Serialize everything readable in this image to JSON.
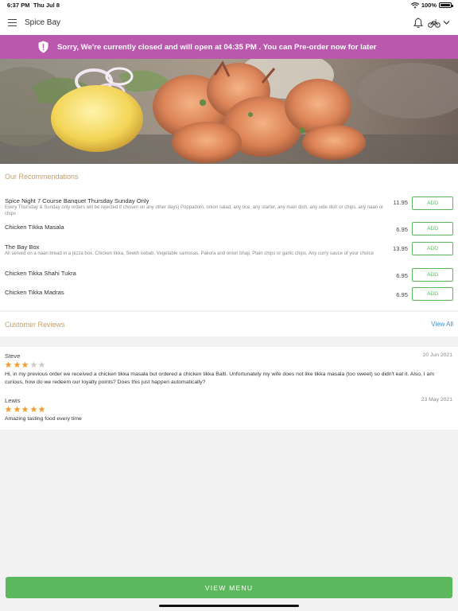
{
  "status_bar": {
    "time": "6:37 PM",
    "date": "Thu Jul 8",
    "battery": "100%"
  },
  "navbar": {
    "title": "Spice Bay"
  },
  "banner": {
    "text": "Sorry, We're currently closed and will open at 04:35 PM . You can Pre-order now for later"
  },
  "recommendations": {
    "title": "Our Recommendations",
    "add_label": "ADD",
    "items": [
      {
        "name": "Spice Night 7 Course Banquet Thursday Sunday Only",
        "description": "Every Thursday & Sunday only orders will be rejected if chosen on any other days) Poppadom, onion salad, any rice, any starter, any main dish, any side dish or chips, any naan or chips",
        "price": "11.95"
      },
      {
        "name": "Chicken TIkka Masala",
        "description": "",
        "price": "6.95"
      },
      {
        "name": "The Bay Box",
        "description": "All served on a naan bread in a pizza box. Chicken tikka, Seekh kebab, Vegetable samosas, Pakora and onion bhaji, Plain chips or garlic chips, Any curry sauce of your choice",
        "price": "13.95"
      },
      {
        "name": "Chicken Tikka Shahi Tukra",
        "description": "",
        "price": "6.95"
      },
      {
        "name": "Chicken Tikka Madras",
        "description": "",
        "price": "6.95"
      }
    ]
  },
  "reviews": {
    "title": "Customer Reviews",
    "view_all": "View All",
    "items": [
      {
        "name": "Steve",
        "date": "20 Jun 2021",
        "rating": 3,
        "max_rating": 5,
        "text": "Hi, in my previous order we received a chicken tikka masala but ordered a chicken tikka Balti. Unfortunately my wife does not like tikka masala (too sweet) so didn't eat it. Also, I am curious, how do we redeem our loyalty points? Does this just happen automatically?"
      },
      {
        "name": "Lewis",
        "date": "23 May 2021",
        "rating": 5,
        "max_rating": 5,
        "text": "Amazing tasting food every time"
      }
    ]
  },
  "footer": {
    "view_menu": "VIEW MENU"
  },
  "colors": {
    "banner": "#b958ad",
    "accent_green": "#5cb85c",
    "section_title": "#c0a070",
    "link": "#3a8fc7",
    "star_filled": "#f0a030",
    "star_empty": "#cccccc"
  }
}
